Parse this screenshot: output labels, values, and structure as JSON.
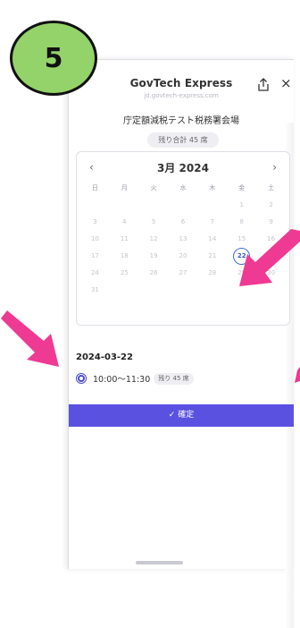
{
  "step": {
    "number": "5",
    "color": "#94d36a"
  },
  "app": {
    "title": "GovTech Express",
    "url": "jd.govtech-express.com",
    "share_icon": "share-icon",
    "close_label": "×"
  },
  "venue": {
    "name": "庁定額減税テスト税務署会場",
    "total_remaining": "残り合計 45 席"
  },
  "calendar": {
    "month_label": "3月 2024",
    "prev": "‹",
    "next": "›",
    "weekdays": [
      "日",
      "月",
      "火",
      "水",
      "木",
      "金",
      "土"
    ],
    "selected_day": "22",
    "days": [
      "",
      "",
      "",
      "",
      "",
      "1",
      "2",
      "3",
      "4",
      "5",
      "6",
      "7",
      "8",
      "9",
      "10",
      "11",
      "12",
      "13",
      "14",
      "15",
      "16",
      "17",
      "18",
      "19",
      "20",
      "21",
      "22",
      "23",
      "24",
      "25",
      "26",
      "27",
      "28",
      "29",
      "30",
      "31",
      "",
      "",
      "",
      "",
      "",
      ""
    ]
  },
  "booking": {
    "date": "2024-03-22",
    "slot_time": "10:00〜11:30",
    "slot_remaining": "残り 45 席"
  },
  "confirm_label": "✓ 確定",
  "colors": {
    "accent": "#5b51e0",
    "arrow": "#ee3a93",
    "selected": "#3b6fd6"
  }
}
